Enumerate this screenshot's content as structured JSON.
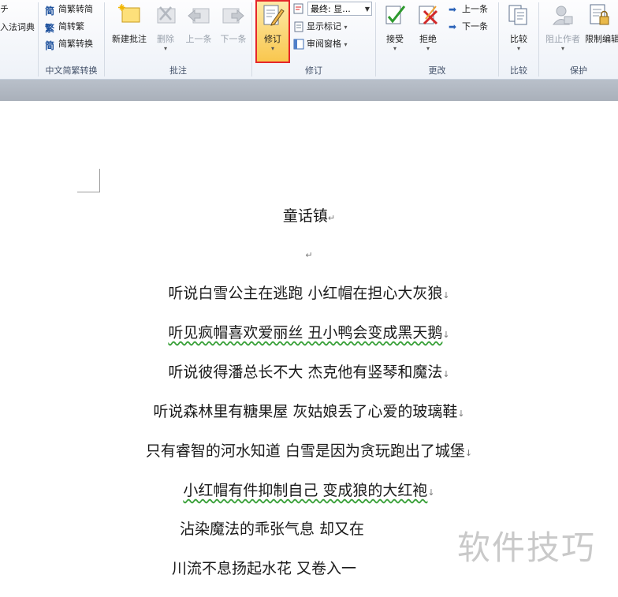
{
  "ribbon": {
    "groups": [
      {
        "label": "中文简繁转换"
      },
      {
        "label": "批注"
      },
      {
        "label": "修订"
      },
      {
        "label": "更改"
      },
      {
        "label": "比较"
      },
      {
        "label": "保护"
      }
    ],
    "ime_dict": "入法词典",
    "ime_top": "チ",
    "chinese": {
      "to_traditional": "简繁转简",
      "to_simplified": "简转繁",
      "convert": "简繁转换"
    },
    "comments": {
      "new": "新建批注",
      "delete": "删除",
      "prev": "上一条",
      "next": "下一条"
    },
    "tracking": {
      "track_changes": "修订",
      "display_mode": "最终: 显...",
      "show_markup": "显示标记",
      "reviewing_pane": "审阅窗格"
    },
    "changes": {
      "accept": "接受",
      "reject": "拒绝",
      "prev": "上一条",
      "next": "下一条"
    },
    "compare": {
      "compare": "比较"
    },
    "protect": {
      "block_authors": "阻止作者",
      "restrict_editing": "限制编辑"
    }
  },
  "highlight_color": "#e5262a",
  "document": {
    "title": "童话镇",
    "lines": [
      "听说白雪公主在逃跑  小红帽在担心大灰狼",
      "听见疯帽喜欢爱丽丝  丑小鸭会变成黑天鹅",
      "听说彼得潘总长不大  杰克他有竖琴和魔法",
      "听说森林里有糖果屋  灰姑娘丢了心爱的玻璃鞋",
      "只有睿智的河水知道  白雪是因为贪玩跑出了城堡",
      "小红帽有件抑制自己  变成狼的大红袍",
      "沾染魔法的乖张气息  却又在",
      "川流不息扬起水花  又卷入一"
    ]
  },
  "watermark": "软件技巧"
}
